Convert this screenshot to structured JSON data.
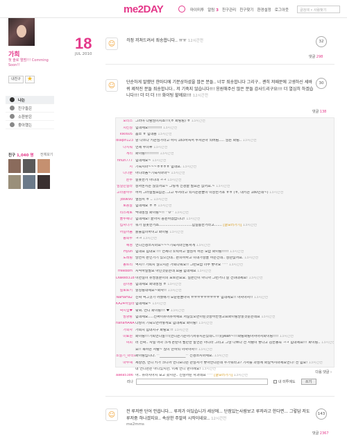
{
  "header": {
    "logo": "me2DAY",
    "nav": [
      "마이미투",
      "알림",
      "친구관리",
      "친구찾기",
      "환경설정",
      "로그아웃"
    ],
    "badge": "3",
    "search_placeholder": "글검색 • 사람찾기"
  },
  "profile": {
    "name": "가희",
    "desc": "첫 솔로 앨범!!! Comming Soon!!",
    "button": "내친구"
  },
  "side_menu": [
    "나는",
    "친구들은",
    "소환받은",
    "좋아했는"
  ],
  "friends": {
    "label": "친구",
    "count": "1,040 명",
    "all": "전체보기"
  },
  "date": {
    "day": "18",
    "month_year": "JUL 2010"
  },
  "posts": [
    {
      "text": "걱정 끼쳐드려서 죄송합니다.. ㅠㅠ",
      "time": "12시간전",
      "comments": "32",
      "likes_label": "댓글",
      "likes": "298"
    },
    {
      "text": "단순하게 말했던 한마디에 기분상하셨을 많은 분들.. 너무 죄송합니다 그리구.. 괜히 저때문에 고생하신 세바퀴 제작진 분들 죄송합니다.. 저 기죽지 않습니다!!! 응원해주신 많은 분들 감사드리구요!!! 더 열심히 하겠습니다!!! 더 더 더 !!! 화이팅 할께요!!!",
      "time": "12시간전",
      "comments": "30",
      "likes_label": "댓글",
      "likes": "138"
    },
    {
      "text": "전 루저란 단어 안씁니다... 루저가 어딨습니가 세상에... 단점있는사람보고 루저라고 한다면... 그렇담 저도 루저중 하나겠지요.. 속상한 주말의 시작이네요..",
      "time": "12시간전",
      "comments": "143",
      "likes_label": "댓글",
      "likes": "2367"
    }
  ],
  "post_meta": "me2mms",
  "comments": [
    {
      "n": "모리스",
      "b": "그러야 다람님이시죠!!!(ㅎ 화팅팅) ㅎ",
      "t": "13시간전"
    },
    {
      "n": "치킨칭",
      "b": "힘내세요!!!!!!!!!!",
      "t": "13시간전"
    },
    {
      "n": "kiki605",
      "b": "홈쪼 ㅎ 힘내용",
      "t": "13시간전"
    },
    {
      "n": "dialph123",
      "b": "양 나쓰다 키큰님가라고 하지 183하셔서 루저는아 되버림..... 암튼 화팅..",
      "t": "13시간전"
    },
    {
      "n": "나지워",
      "b": "언제 부의후",
      "t": "13시간전"
    },
    {
      "n": "게리",
      "b": "화이팅!!!!!!!!!!",
      "t": "13시간전"
    },
    {
      "n": "hhun777",
      "b": "힘내세요~",
      "t": "13시간전"
    },
    {
      "n": "지",
      "b": "기죽지마~~~ㅎㅎㅎㅎ 힘내요.",
      "t": "13시간전"
    },
    {
      "n": "나나뿐",
      "b": "아니라움~기죽지마마~",
      "t": "13시간전"
    },
    {
      "n": "원두",
      "b": "잘못한거 아니데 ㅋㅋ",
      "t": "13시간전"
    },
    {
      "n": "임일민철라",
      "b": "상처받지는 않았어요~ 그렇게 신경쓸 필요는 없어요.~",
      "t": "13시간전"
    },
    {
      "n": "고라팡하우",
      "b": "허허 그러실필요없는..그고 루저라고 되지는분들이 이상한거죠 ㅎㅎ (ㅎ, 내키는 180인데~)",
      "t": "13시간전"
    },
    {
      "n": "jdsw90",
      "b": "열심히 ㅎ ..",
      "t": "13시간전"
    },
    {
      "n": "로둥알",
      "b": "힘내세요 ㅎ ㅎ",
      "t": "13시간전"
    },
    {
      "n": "리스체토",
      "b": "딱대장님 화이팅~!! ^0^",
      "t": "13시간전"
    },
    {
      "n": "블루해다",
      "b": "힘내세요! 끝까지 응원하겠습니다!",
      "t": "13시간전"
    },
    {
      "n": "접자나가",
      "b": "뭐가 잘못한거죠..............................힘일롱한거라고.......",
      "t": "13시간전",
      "s": "[글보러가기]"
    },
    {
      "n": "어길어둠",
      "b": "틀룰힘이하이고 화이팅",
      "t": "13시간전"
    },
    {
      "n": "송희루",
      "b": "ㅋㅋ",
      "t": "13시간전"
    },
    {
      "n": "혜정",
      "b": "언니신경쓰지마요~~~기죽지마신랑처게",
      "t": "13시간전"
    },
    {
      "n": "Hyun",
      "b": "힘내요 힘내요 !!! 언제나 노력하고 열심히 하는 모습 화이팅!!!!!",
      "t": "13시간전"
    },
    {
      "n": "도레팅",
      "b": "당연히 본인가기 있으신데.. 본의하하고 이내가상을 하는건데.. 상관없어요.",
      "t": "13시간전"
    },
    {
      "n": "동트리",
      "b": "역시!! 가희치 않으시는 가희다워요!! 그런모습 너무 좋아요 ^^",
      "t": "13시간전"
    },
    {
      "n": "freedom",
      "b": "시작하실필요 아닌것같은데 요즘 힘내세요",
      "t": "13시간전"
    },
    {
      "n": "Diake8318",
      "b": "이번일이 유명할분이의 포르면요요. 일본인이 아니까 그런거니 잘 견뎌내세요!",
      "t": "13시간전"
    },
    {
      "n": "김이용",
      "b": "힘내세요 화대장님 ㅎ",
      "t": "13시간전"
    },
    {
      "n": "설로토키",
      "b": "할성팅내세요~화사!!",
      "t": "13시간전"
    },
    {
      "n": "NaHaHa2",
      "b": "진짜 억그것가 어쨌해가 모순된들아여 ㅠㅠㅠㅠㅠㅠㅠㅠㅠ 힘내세요!! 아자아자!!",
      "t": "13시간전"
    },
    {
      "n": "KA24하일라",
      "b": "힘내세요~",
      "t": "13시간전"
    },
    {
      "n": "박지엽♥",
      "b": "쉿휘. 언니 화이팅!!! ♥",
      "t": "13시간전"
    },
    {
      "n": "밤향랑",
      "b": "힘내세요.....진짜이유이유하세요 저갈았오면이린것상하한생고요화이팅당할것같은데요",
      "t": "13시간전"
    },
    {
      "n": "nanaHANA",
      "b": "다장이 기죽으면어떻게요 힘내세요 화이팅!",
      "t": "13시간전"
    },
    {
      "n": "가희사",
      "b": "가희치 힘내시구 화팅요 !!",
      "t": "13시간전"
    },
    {
      "n": "미료원",
      "b": "화이팅!!!가희언니말!!!(언니는기는아기저유지는있네ㄴ!!!)(yeah~!!!화팅화팅아자아자파이팅!!!!",
      "t": "13시간전"
    },
    {
      "n": "여피",
      "b": "러 진짜.. 사실 어차 크게 논란이 될만한 발언은 아니라 그리고 그냥 나쁘다 전 사람이 좋다고 김한동쪽 ㅋㅋ 힘내세요!!! 화이팅..",
      "t": "13시간전"
    },
    {
      "n": "",
      "b": "요!! 욕하는 사람~ 많이 안하되 아자아자!!",
      "t": "13시간전"
    },
    {
      "n": "소알기_마리오",
      "b": "화이팅입니다. ^_______________^ 신경쓰지마세요.",
      "t": "13시간전"
    },
    {
      "n": "마루예",
      "b": "세상엔, 언니 키가 크니까 언니보다는 큰남자가 좋아한다는데 누가뭐라고? 기자를 과장에 화일먹지마세요언니! 전 힘요!",
      "t": "13시간전"
    },
    {
      "n": "",
      "b": "내 언니편은 아니었지만, 이제 언니 편이에요!",
      "t": "13시간전"
    },
    {
      "n": "aaea5386",
      "b": "아.. 유라시아치 보고 왔지만.. 진심어린 사과네요 ^^",
      "t": "13시간전",
      "s": "[글보러가기]"
    }
  ],
  "comment_more": "다음 댓글 ›",
  "reply": {
    "label": "리나",
    "check_label": "내 미투에도",
    "submit": "쓰기"
  }
}
